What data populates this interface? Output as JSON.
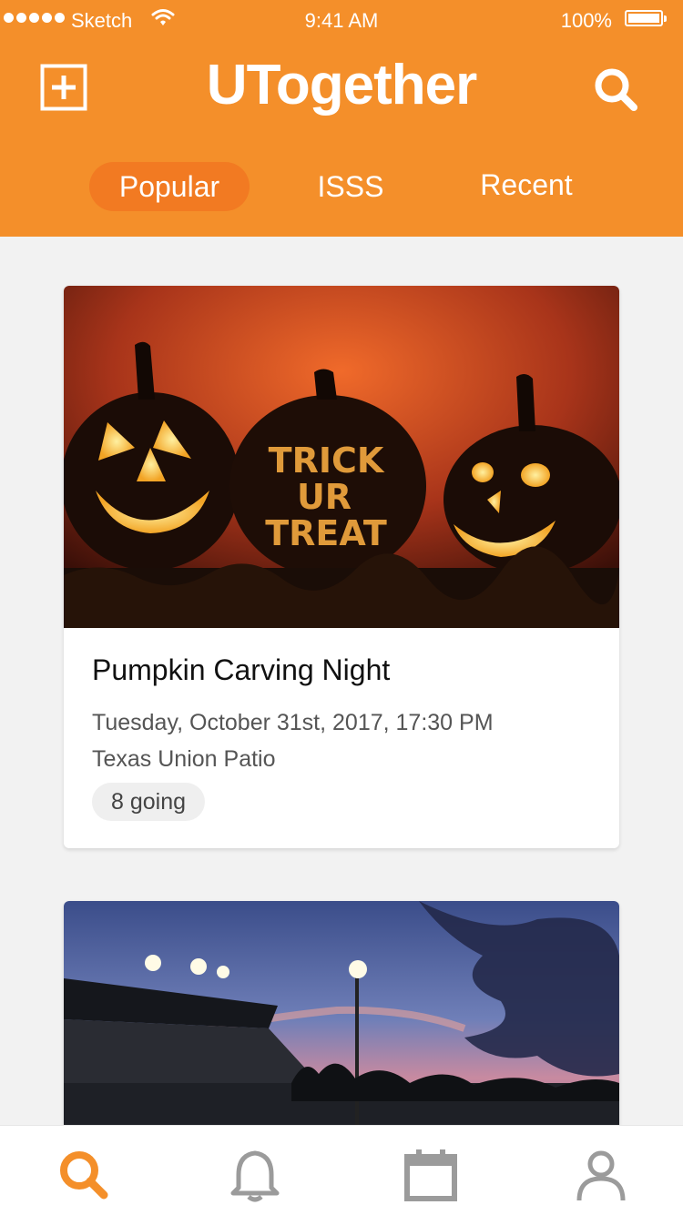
{
  "status_bar": {
    "carrier": "Sketch",
    "time": "9:41 AM",
    "battery": "100%"
  },
  "header": {
    "title": "UTogether",
    "add_icon": "plus-square-icon",
    "search_icon": "search-icon",
    "background_color": "#f48f2a",
    "active_tab_color": "#f27a22"
  },
  "tabs": [
    {
      "label": "Popular",
      "active": true
    },
    {
      "label": "ISSS",
      "active": false
    },
    {
      "label": "Recent",
      "active": false
    }
  ],
  "events": [
    {
      "image": "halloween-pumpkins-trick-or-treat",
      "title": "Pumpkin Carving Night",
      "date": "Tuesday, October 31st, 2017, 17:30 PM",
      "location": "Texas Union Patio",
      "going": "8 going"
    },
    {
      "image": "stadium-at-dusk"
    }
  ],
  "bottom_nav": [
    {
      "icon": "search-icon",
      "active": true,
      "color": "#f48f2a"
    },
    {
      "icon": "bell-icon",
      "active": false,
      "color": "#9b9b9b"
    },
    {
      "icon": "calendar-icon",
      "active": false,
      "color": "#9b9b9b"
    },
    {
      "icon": "user-icon",
      "active": false,
      "color": "#9b9b9b"
    }
  ]
}
